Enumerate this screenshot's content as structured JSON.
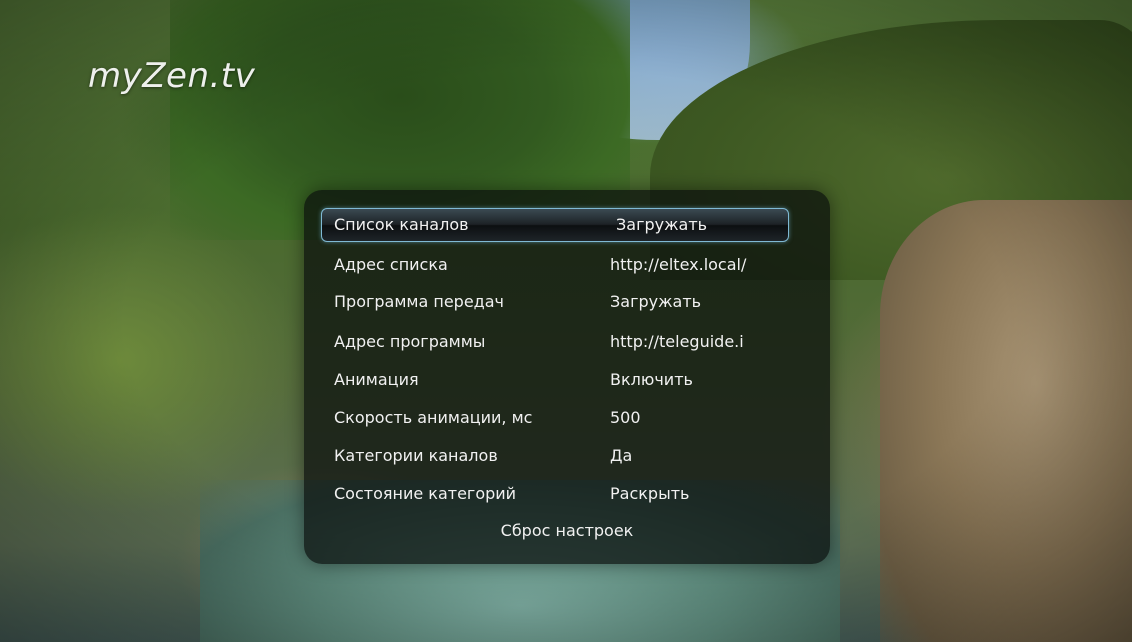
{
  "logo_text": "myZen.tv",
  "settings": {
    "items": [
      {
        "label": "Список каналов",
        "value": "Загружать",
        "selected": true
      },
      {
        "label": "Адрес списка",
        "value": "http://eltex.local/",
        "selected": false
      },
      {
        "label": "Программа передач",
        "value": "Загружать",
        "selected": false
      },
      {
        "label": "Адрес программы",
        "value": "http://teleguide.i",
        "selected": false
      },
      {
        "label": "Анимация",
        "value": "Включить",
        "selected": false
      },
      {
        "label": "Скорость анимации, мс",
        "value": "500",
        "selected": false
      },
      {
        "label": "Категории каналов",
        "value": "Да",
        "selected": false
      },
      {
        "label": "Состояние категорий",
        "value": "Раскрыть",
        "selected": false
      }
    ],
    "reset_label": "Сброс настроек"
  },
  "colors": {
    "selection_border": "#7fb9d4",
    "panel_background": "rgba(10,14,12,0.72)",
    "text": "#f1f1f1"
  }
}
